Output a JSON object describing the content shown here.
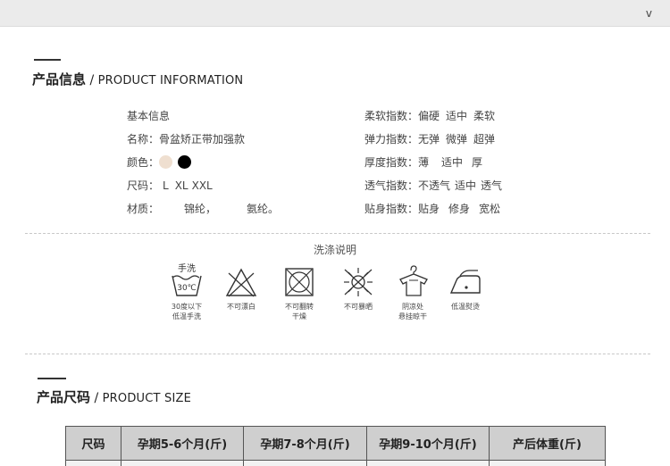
{
  "header": {
    "collapse_icon": "chevron-down-icon",
    "collapse_glyph": "v"
  },
  "product_info": {
    "title_zh": "产品信息",
    "title_sep": " / ",
    "title_en": "PRODUCT INFORMATION",
    "left": {
      "basic": "基本信息",
      "name_label": "名称：",
      "name_value": "骨盆矫正带加强款",
      "color_label": "颜色：",
      "colors": [
        "#efdfd0",
        "#000000"
      ],
      "size_label": "尺码：",
      "sizes": [
        "L",
        "XL",
        "XXL"
      ],
      "material_label": "材质：",
      "materials": [
        "锦纶，",
        "氨纶。"
      ]
    },
    "right": [
      {
        "label": "柔软指数：",
        "options": [
          "偏硬",
          "适中",
          "柔软"
        ]
      },
      {
        "label": "弹力指数：",
        "options": [
          "无弹",
          "微弹",
          "超弹"
        ]
      },
      {
        "label": "厚度指数：",
        "options": [
          "薄",
          "适中",
          "厚"
        ]
      },
      {
        "label": "透气指数：",
        "options": [
          "不透气",
          "适中",
          "透气"
        ]
      },
      {
        "label": "贴身指数：",
        "options": [
          "贴身",
          "修身",
          "宽松"
        ]
      }
    ]
  },
  "washing": {
    "title": "洗涤说明",
    "items": [
      {
        "icon": "hand-wash-30-icon",
        "top_label": "手洗",
        "temp": "30℃",
        "caption": [
          "30度以下",
          "低温手洗"
        ]
      },
      {
        "icon": "no-bleach-icon",
        "caption": [
          "不可漂白"
        ]
      },
      {
        "icon": "no-tumble-dry-icon",
        "caption": [
          "不可翻转",
          "干燥"
        ]
      },
      {
        "icon": "no-sun-icon",
        "caption": [
          "不可暴晒"
        ]
      },
      {
        "icon": "hang-dry-shade-icon",
        "caption": [
          "阴凉处",
          "悬挂晾干"
        ]
      },
      {
        "icon": "low-iron-icon",
        "caption": [
          "低温熨烫"
        ]
      }
    ]
  },
  "product_size": {
    "title_zh": "产品尺码",
    "title_sep": " / ",
    "title_en": "PRODUCT SIZE",
    "headers": [
      "尺码",
      "孕期5-6个月(斤)",
      "孕期7-8个月(斤)",
      "孕期9-10个月(斤)",
      "产后体重(斤)"
    ]
  }
}
